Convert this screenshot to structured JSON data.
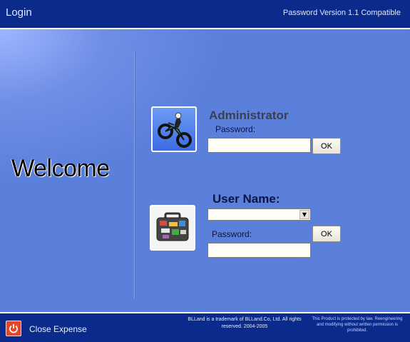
{
  "header": {
    "title": "Login",
    "subtitle": "Password Version 1.1 Compatible"
  },
  "welcome": "Welcome",
  "admin": {
    "heading": "Administrator",
    "password_label": "Password:",
    "password_value": "",
    "ok_label": "OK",
    "avatar_icon": "motorcycle-jump-icon"
  },
  "user": {
    "heading": "User Name:",
    "selected_user": "",
    "password_label": "Password:",
    "password_value": "",
    "ok_label": "OK",
    "avatar_icon": "suitcase-icon"
  },
  "footer": {
    "close_label": "Close Expense",
    "trademark": "BLLand is a trademark of BLLand.Co, Ltd. All rights reserved. 2004-2005",
    "legal": "This Product is protected by law. Reengineering and modifying without written permission is prohibited.",
    "close_icon": "power-icon"
  },
  "colors": {
    "header_bg": "#0a2b8c",
    "panel_bg": "#5a7fdb",
    "close_button": "#e4462a"
  }
}
